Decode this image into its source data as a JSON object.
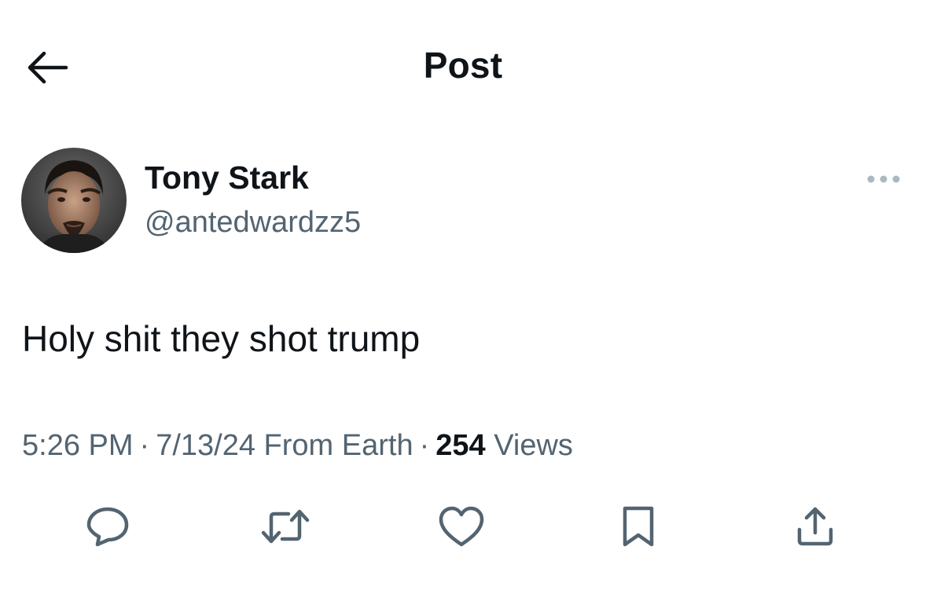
{
  "header": {
    "title": "Post",
    "back_icon": "arrow-left-icon"
  },
  "author": {
    "display_name": "Tony Stark",
    "handle": "@antedwardzz5",
    "avatar": "profile-photo"
  },
  "post": {
    "text": "Holy shit they shot trump",
    "time": "5:26 PM",
    "separator": "·",
    "date": "7/13/24",
    "location": "From Earth",
    "views_count": "254",
    "views_label": "Views"
  },
  "actions": [
    {
      "name": "reply",
      "icon": "reply-icon"
    },
    {
      "name": "repost",
      "icon": "repost-icon"
    },
    {
      "name": "like",
      "icon": "heart-icon"
    },
    {
      "name": "bookmark",
      "icon": "bookmark-icon"
    },
    {
      "name": "share",
      "icon": "share-icon"
    }
  ],
  "colors": {
    "text_primary": "#0f1419",
    "text_secondary": "#536471",
    "icon": "#536471",
    "background": "#ffffff"
  }
}
